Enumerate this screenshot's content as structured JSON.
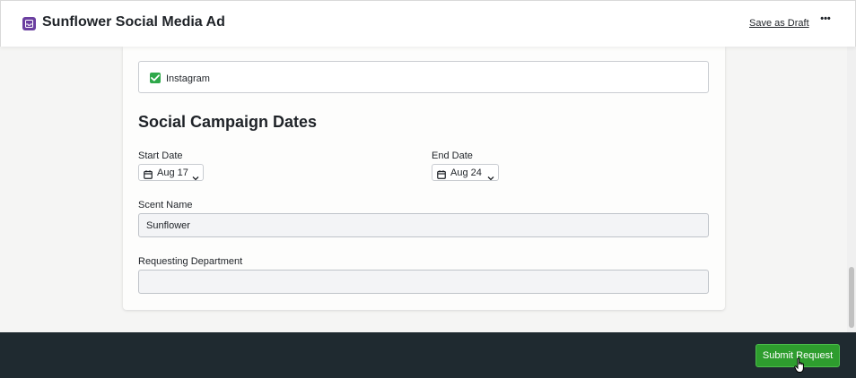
{
  "header": {
    "title": "Sunflower Social Media Ad",
    "save_draft_label": "Save as Draft",
    "more_label": "•••",
    "app_icon": "inbox-icon"
  },
  "form": {
    "platform_option": {
      "label": "Instagram",
      "checked": true
    },
    "section_title": "Social Campaign Dates",
    "start_date": {
      "label": "Start Date",
      "value": "Aug 17"
    },
    "end_date": {
      "label": "End Date",
      "value": "Aug 24"
    },
    "scent_name": {
      "label": "Scent Name",
      "value": "Sunflower"
    },
    "requesting_department": {
      "label": "Requesting Department",
      "value": ""
    }
  },
  "footer": {
    "submit_label": "Submit Request"
  },
  "colors": {
    "accent": "#6b3fa0",
    "submit": "#2e9d2e",
    "checkbox": "#2ea84a",
    "footer_bg": "#1f2a30"
  }
}
